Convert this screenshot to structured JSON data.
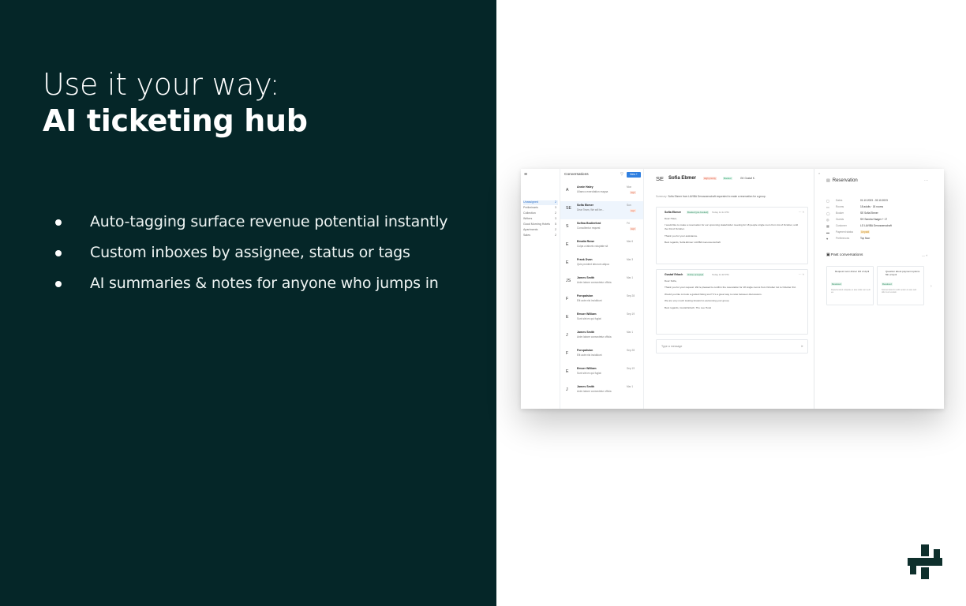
{
  "slide": {
    "headline_line1": "Use it your way:",
    "headline_line2": "AI ticketing hub",
    "bullets": [
      "Auto-tagging surface revenue potential instantly",
      "Custom inboxes by assignee, status or tags",
      "AI summaries & notes for anyone who jumps in"
    ],
    "colors": {
      "panel": "#052628",
      "text": "#ffffff",
      "accent": "#2f7fe0"
    }
  },
  "app": {
    "nav": {
      "menu_icon": "≡",
      "items": [
        {
          "label": "Unassigned",
          "count": "2"
        },
        {
          "label": "Preliminaris",
          "count": "3"
        },
        {
          "label": "Collection",
          "count": "2"
        },
        {
          "label": "Writers",
          "count": "3"
        },
        {
          "label": "Good Morning Hotels",
          "count": "5"
        },
        {
          "label": "Apartments",
          "count": "2"
        },
        {
          "label": "Sales",
          "count": "2"
        }
      ]
    },
    "conversations": {
      "title": "Conversations",
      "new_label": "New +",
      "items": [
        {
          "avatar": "A",
          "name": "Annie Haley",
          "preview": "Ullamco exercitation magna",
          "date": "Mon",
          "tag": "High"
        },
        {
          "avatar": "SE",
          "name": "Sofia Ebmer",
          "preview": "Dear Team, We will be...",
          "date": "Sun",
          "tag": "High"
        },
        {
          "avatar": "S",
          "name": "Sofina Bodierford",
          "preview": "Consollentur request",
          "date": "Fri",
          "tag": "High"
        },
        {
          "avatar": "E",
          "name": "Emalia Rowe",
          "preview": "Culpa a laboris voluptate sit",
          "date": "Mar 6",
          "tag": ""
        },
        {
          "avatar": "E",
          "name": "Frank Dvan",
          "preview": "Quis proident laborum aliqua",
          "date": "Mar 3",
          "tag": ""
        },
        {
          "avatar": "JS",
          "name": "James Smith",
          "preview": "Anim labore consectetur officia",
          "date": "Mar 1",
          "tag": ""
        },
        {
          "avatar": "F",
          "name": "Forcpalsion",
          "preview": "Elit aute nisi incididunt",
          "date": "Sep 28",
          "tag": ""
        },
        {
          "avatar": "E",
          "name": "Emser William",
          "preview": "Sunt sint ex qui fugiat",
          "date": "Sep 19",
          "tag": ""
        },
        {
          "avatar": "J",
          "name": "James Smith",
          "preview": "Anim labore consectetur officia",
          "date": "Mar 1",
          "tag": ""
        },
        {
          "avatar": "F",
          "name": "Forcpalsion",
          "preview": "Elit aute nisi incididunt",
          "date": "Sep 28",
          "tag": ""
        },
        {
          "avatar": "E",
          "name": "Emser William",
          "preview": "Sunt sint ex qui fugiat",
          "date": "Sep 19",
          "tag": ""
        },
        {
          "avatar": "J",
          "name": "James Smith",
          "preview": "Anim labore consectetur officia",
          "date": "Mar 1",
          "tag": ""
        }
      ]
    },
    "chat": {
      "avatar": "SE",
      "name": "Sofia Ebmer",
      "tag_priority": "High priority",
      "tag_status": "Booked",
      "assignee": "GK  Gustaf K.",
      "summary_label": "Summary",
      "summary": "Sofia Ebmer from LAVIBA Genossenschaft requested to make a reservation for a group.",
      "messages": [
        {
          "from": "Sofia Ebmer",
          "badge": "Booked (pre-booked)",
          "time": "Today 11:12 PM",
          "body": [
            "Dear Hotel,",
            "I would like to make a reservation for our upcoming stakeholder meeting for 18 people single room from 1st of October, until the 3rd of October.",
            "Thank you for your assistance.",
            "Best regards, Sofia Ebmer LAVIBA Genossenschaft"
          ]
        },
        {
          "from": "Gustaf Erlach",
          "badge": "Online accepted",
          "time": "Today 11:18 PM",
          "body": [
            "Dear Sofia,",
            "Thank you for your request. We're pleased to confirm the reservation for 18 single rooms from October 1st to October 3rd.",
            "Would you like to book a guided hiking tour? It's a great way to relax between discussions.",
            "We are very much looking forward to welcoming your group.",
            "Best regards, Gustaf Erlach, The Lee Hotel"
          ]
        }
      ],
      "input_placeholder": "Type a message",
      "send_icon": "➤"
    },
    "reservation": {
      "title": "Reservation",
      "rows": [
        {
          "icon": "calendar-icon",
          "key": "Dates",
          "value": "01.10.2023 - 03.10.2023"
        },
        {
          "icon": "room-icon",
          "key": "Rooms",
          "value": "18 adults · 18 rooms"
        },
        {
          "icon": "user-icon",
          "key": "Booker",
          "value": "SE  Sofia Ebmer"
        },
        {
          "icon": "guest-icon",
          "key": "Guests",
          "value": "SH  Sandra Haager + 17"
        },
        {
          "icon": "company-icon",
          "key": "Customer",
          "value": "LG  LAVIBA Genossenschaft"
        },
        {
          "icon": "payment-icon",
          "key": "Payment status",
          "value": "Unpaid"
        },
        {
          "icon": "heart-icon",
          "key": "Preferences",
          "value": "Top floor"
        }
      ],
      "past_title": "Past conversations",
      "past": [
        {
          "title": "Request room dinner 3rd of April",
          "status": "Resolved",
          "desc": "Reprehenderit voluptate et aute dolor sunt velit ea."
        },
        {
          "title": "Question about payment options 5th of April",
          "status": "Resolved",
          "desc": "Nostrud dolor lit mollit veniam in aute velit dolor sunt veniam."
        }
      ]
    }
  }
}
